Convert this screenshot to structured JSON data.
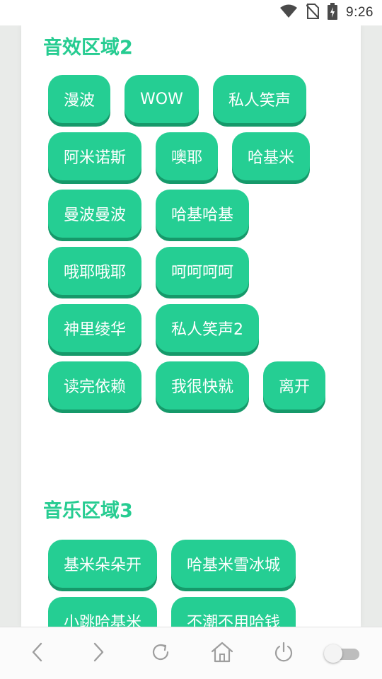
{
  "status_bar": {
    "time": "9:26",
    "icons": [
      "wifi-icon",
      "no-sim-icon",
      "battery-charging-icon"
    ]
  },
  "sections": [
    {
      "title": "音效区域2",
      "buttons": [
        "漫波",
        "WOW",
        "私人笑声",
        "阿米诺斯",
        "噢耶",
        "哈基米",
        "曼波曼波",
        "哈基哈基",
        "哦耶哦耶",
        "呵呵呵呵",
        "神里绫华",
        "私人笑声2",
        "读完依赖",
        "我很快就",
        "离开"
      ]
    },
    {
      "title": "音乐区域3",
      "buttons": [
        "基米朵朵开",
        "哈基米雪冰城",
        "小跳哈基米",
        "不潮不用哈钱"
      ]
    }
  ],
  "nav_bar": {
    "icons": [
      "back-icon",
      "forward-icon",
      "refresh-icon",
      "home-icon",
      "power-icon",
      "toggle-switch"
    ],
    "toggle_on": false
  },
  "colors": {
    "accent": "#26cc91",
    "button": "#25ce93",
    "button_shadow": "#16996a"
  }
}
